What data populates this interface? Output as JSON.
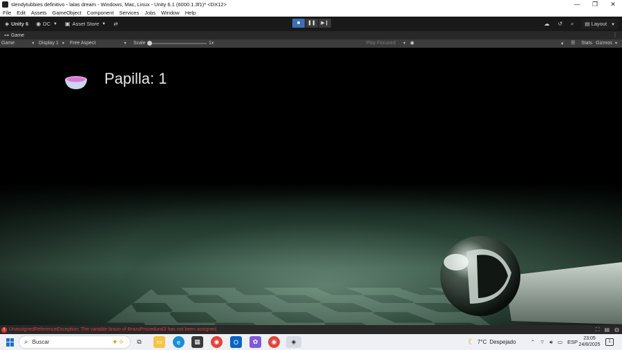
{
  "window": {
    "title": "slendytubbies  definitivo - lalas dream - Windows, Mac, Linux - Unity 6.1 (6000.1.3f1)* <DX12>",
    "controls": [
      "—",
      "❐",
      "✕"
    ]
  },
  "menu": [
    "File",
    "Edit",
    "Assets",
    "GameObject",
    "Component",
    "Services",
    "Jobs",
    "Window",
    "Help"
  ],
  "toolbar": {
    "unity_label": "Unity 6",
    "account_label": "DC",
    "asset_store_label": "Asset Store",
    "layout_label": "Layout"
  },
  "tab": {
    "label": "Game"
  },
  "gamebar": {
    "mode": "Game",
    "display": "Display 1",
    "aspect": "Free Aspect",
    "scale_label": "Scale",
    "scale_value": "1x",
    "play_focused": "Play Focused",
    "stats": "Stats",
    "gizmos": "Gizmos"
  },
  "hud": {
    "label": "Papilla: 1",
    "bowl_color": "#e88be0"
  },
  "status": {
    "error": "UnassignedReferenceException: The variable brazo of BrazoProcedural3 has not been assigned."
  },
  "taskbar": {
    "search_placeholder": "Buscar",
    "weather_temp": "7°C",
    "weather_desc": "Despejado",
    "lang": "ESP",
    "time": "23:05",
    "date": "24/8/2025",
    "notifications": "1"
  },
  "colors": {
    "accent": "#3b6fb4",
    "error": "#d04040"
  }
}
